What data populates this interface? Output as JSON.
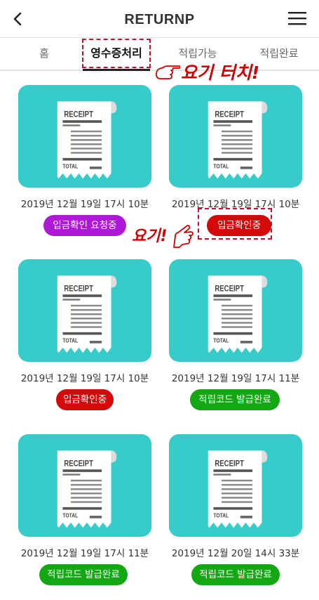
{
  "header": {
    "back_icon": "chevron-left-icon",
    "title": "RETURNP",
    "menu_icon": "hamburger-menu-icon"
  },
  "tabs": [
    {
      "label": "홈",
      "active": false
    },
    {
      "label": "영수증처리",
      "active": true
    },
    {
      "label": "적립가능",
      "active": false
    },
    {
      "label": "적립완료",
      "active": false
    }
  ],
  "annotations": {
    "touch_here": "요기 터치!",
    "here": "요기!"
  },
  "receipt_text": {
    "header": "RECEIPT",
    "footer": "TOTAL"
  },
  "colors": {
    "card_bg": "#37cbc9",
    "badge_purple": "#b018d8",
    "badge_red": "#d40a0a",
    "badge_green": "#13a813",
    "annotation_red": "#d00000"
  },
  "receipts": [
    {
      "date": "2019년 12월 19일 17시 10분",
      "status": "입금확인 요청중",
      "status_color": "purple"
    },
    {
      "date": "2019년 12월 19일 17시 10분",
      "status": "입금확인중",
      "status_color": "red"
    },
    {
      "date": "2019년 12월 19일 17시 10분",
      "status": "입금확인중",
      "status_color": "red"
    },
    {
      "date": "2019년 12월 19일 17시 11분",
      "status": "적립코드 발급완료",
      "status_color": "green"
    },
    {
      "date": "2019년 12월 19일 17시 11분",
      "status": "적립코드 발급완료",
      "status_color": "green"
    },
    {
      "date": "2019년 12월 20일 14시 33분",
      "status": "적립코드 발급완료",
      "status_color": "green"
    }
  ]
}
